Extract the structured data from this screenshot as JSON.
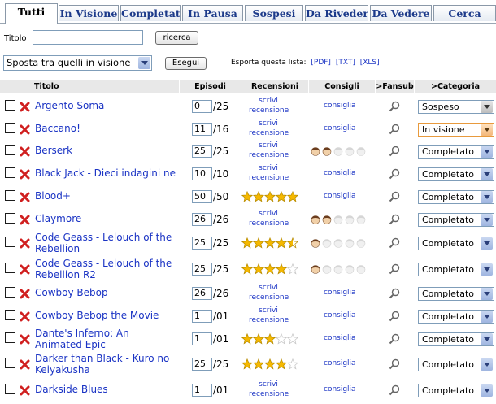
{
  "tabs": [
    "Tutti",
    "In Visione",
    "Completati",
    "In Pausa",
    "Sospesi",
    "Da Rivedere",
    "Da Vedere",
    "Cerca"
  ],
  "search": {
    "label": "Titolo",
    "value": "",
    "button": "ricerca"
  },
  "actions": {
    "selected": "Sposta tra quelli in visione",
    "button": "Esegui",
    "export_label": "Esporta questa lista:",
    "export_links": [
      "[PDF]",
      "[TXT]",
      "[XLS]"
    ]
  },
  "columns": [
    "Titolo",
    "Episodi",
    "Recensioni",
    "Consigli",
    ">Fansub",
    ">Categoria"
  ],
  "recensioni_link": [
    "scrivi",
    "recensione"
  ],
  "consiglia_label": "consiglia",
  "rows": [
    {
      "title": "Argento Soma",
      "ep": "0",
      "tot": "/25",
      "review": "link",
      "heads": 0,
      "cat": "Sospeso"
    },
    {
      "title": "Baccano!",
      "ep": "11",
      "tot": "/16",
      "review": "link",
      "heads": 0,
      "cat": "In visione"
    },
    {
      "title": "Berserk",
      "ep": "25",
      "tot": "/25",
      "review": "link",
      "heads": 2,
      "cat": "Completato"
    },
    {
      "title": "Black Jack - Dieci indagini ne",
      "ep": "10",
      "tot": "/10",
      "review": "link",
      "heads": 0,
      "cat": "Completato"
    },
    {
      "title": "Blood+",
      "ep": "50",
      "tot": "/50",
      "review": 5,
      "heads": 0,
      "cat": "Completato"
    },
    {
      "title": "Claymore",
      "ep": "26",
      "tot": "/26",
      "review": "link",
      "heads": 2,
      "cat": "Completato"
    },
    {
      "title": "Code Geass - Lelouch of the Rebellion",
      "ep": "25",
      "tot": "/25",
      "review": 4.5,
      "heads": 1,
      "cat": "Completato"
    },
    {
      "title": "Code Geass - Lelouch of the Rebellion R2",
      "ep": "25",
      "tot": "/25",
      "review": 4,
      "heads": 1,
      "cat": "Completato"
    },
    {
      "title": "Cowboy Bebop",
      "ep": "26",
      "tot": "/26",
      "review": "link",
      "heads": 0,
      "cat": "Completato"
    },
    {
      "title": "Cowboy Bebop the Movie",
      "ep": "1",
      "tot": "/01",
      "review": "link",
      "heads": 0,
      "cat": "Completato"
    },
    {
      "title": "Dante's Inferno: An Animated Epic",
      "ep": "1",
      "tot": "/01",
      "review": 3,
      "heads": 0,
      "cat": "Completato"
    },
    {
      "title": "Darker than Black - Kuro no Keiyakusha",
      "ep": "25",
      "tot": "/25",
      "review": 4,
      "heads": 0,
      "cat": "Completato"
    },
    {
      "title": "Darkside Blues",
      "ep": "1",
      "tot": "/01",
      "review": "link",
      "heads": 0,
      "cat": "Completato"
    }
  ],
  "colors": {
    "link": "#1a33c4",
    "tab_text": "#1c3a8a",
    "delete": "#d02020",
    "star_on": "#f5b800",
    "star_off": "#d8d8d8"
  }
}
